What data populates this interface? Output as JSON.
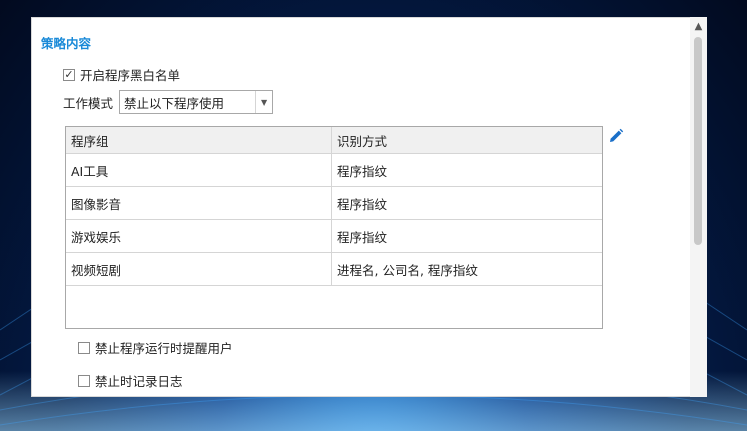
{
  "policy": {
    "section_title": "策略内容",
    "enable_blacklist": {
      "label": "开启程序黑白名单",
      "checked": true
    },
    "work_mode": {
      "label": "工作模式",
      "value": "禁止以下程序使用"
    },
    "table": {
      "headers": [
        "程序组",
        "识别方式"
      ],
      "rows": [
        [
          "AI工具",
          "程序指纹"
        ],
        [
          "图像影音",
          "程序指纹"
        ],
        [
          "游戏娱乐",
          "程序指纹"
        ],
        [
          "视频短剧",
          "进程名, 公司名, 程序指纹"
        ]
      ]
    },
    "notify_user": {
      "label": "禁止程序运行时提醒用户",
      "checked": false
    },
    "log_on_block": {
      "label": "禁止时记录日志",
      "checked": false
    }
  },
  "icons": {
    "edit": "pencil-icon",
    "dropdown": "caret-down-icon",
    "scroll_up": "caret-up-icon"
  },
  "colors": {
    "accent": "#1a8ad8",
    "background": "#031a44"
  }
}
